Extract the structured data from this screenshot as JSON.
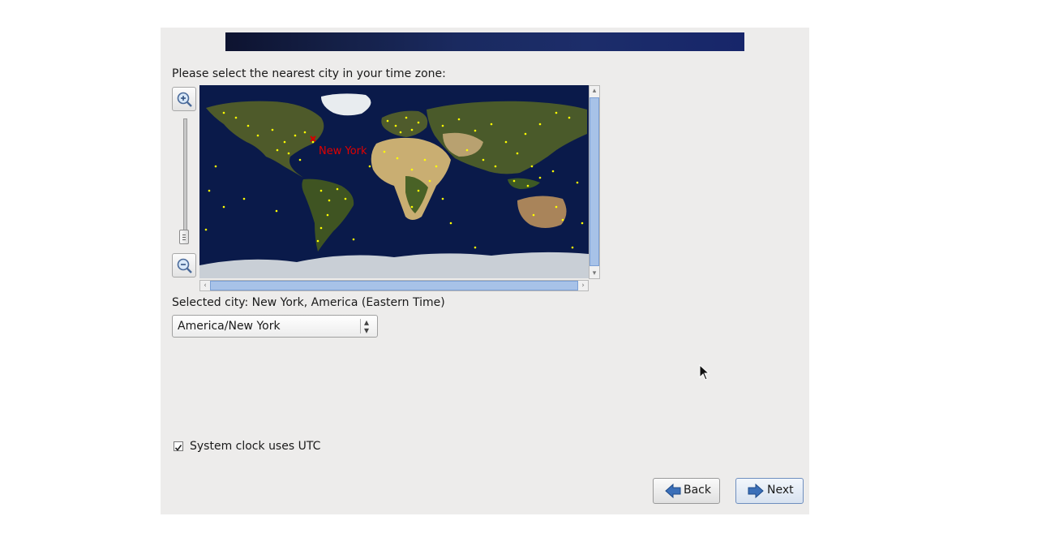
{
  "timezone": {
    "prompt": "Please select the nearest city in your time zone:",
    "map_marker_city": "New York",
    "selected_city_text": "Selected city: New York, America (Eastern Time)",
    "zone_select_value": "America/New York",
    "utc_checkbox_label": "System clock uses UTC",
    "utc_checked": true
  },
  "buttons": {
    "back_label": "Back",
    "next_label": "Next"
  },
  "colors": {
    "marker": "#d40000",
    "city_dot": "#ffff00",
    "ocean": "#0a1a4a",
    "scroll_thumb": "#a7c2e8"
  }
}
